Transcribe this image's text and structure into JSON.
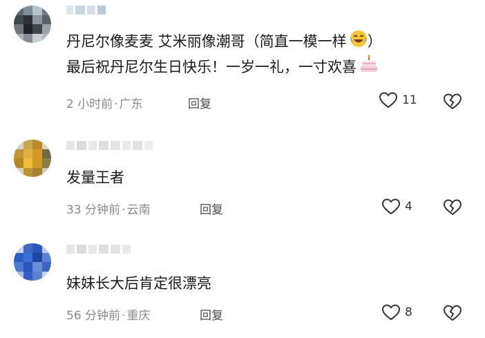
{
  "comments": [
    {
      "text_lines": [
        "丹尼尔像麦麦 艾米丽像潮哥（简直一模一样",
        "最后祝丹尼尔生日快乐！一岁一礼，一寸欢喜"
      ],
      "text_tail": "）",
      "time": "2 小时前",
      "location": "广东",
      "reply_label": "回复",
      "likes": "11",
      "emoji": [
        "laughing-crying-emoji",
        "birthday-cake-emoji"
      ]
    },
    {
      "text_lines": [
        "发量王者"
      ],
      "time": "33 分钟前",
      "location": "云南",
      "reply_label": "回复",
      "likes": "4"
    },
    {
      "text_lines": [
        "妹妹长大后肯定很漂亮"
      ],
      "time": "56 分钟前",
      "location": "重庆",
      "reply_label": "回复",
      "likes": "8"
    }
  ],
  "separator": "·",
  "colors": {
    "text": "#1a1a1a",
    "meta": "#8a8a8a",
    "icon": "#333333"
  }
}
